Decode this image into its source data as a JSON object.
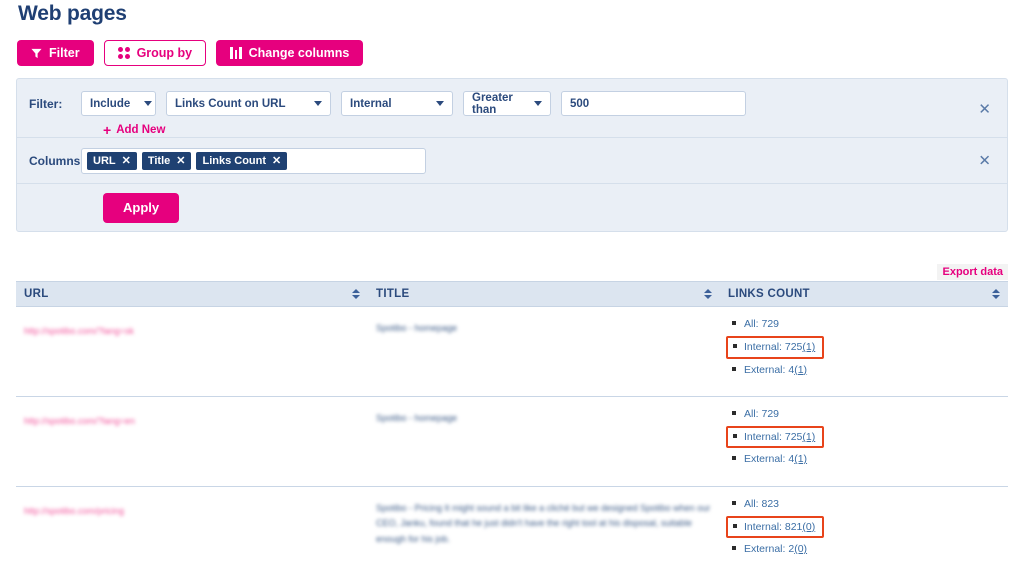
{
  "header": {
    "title": "Web pages"
  },
  "toolbar": {
    "filter_label": "Filter",
    "group_by_label": "Group by",
    "change_columns_label": "Change columns"
  },
  "filter_panel": {
    "filter_label": "Filter:",
    "columns_label": "Columns:",
    "selects": [
      {
        "name": "include-mode",
        "value": "Include"
      },
      {
        "name": "metric",
        "value": "Links Count on URL"
      },
      {
        "name": "link-type",
        "value": "Internal"
      },
      {
        "name": "comparator",
        "value": "Greater than"
      }
    ],
    "value_input": "500",
    "value_placeholder": "",
    "add_new_label": "Add New",
    "add_new_plus": "+",
    "remove_icon": "✕",
    "columns_chips": [
      {
        "label": "URL",
        "remove": "✕"
      },
      {
        "label": "Title",
        "remove": "✕"
      },
      {
        "label": "Links Count",
        "remove": "✕"
      }
    ],
    "apply_label": "Apply"
  },
  "table": {
    "export_label": "Export data",
    "columns": [
      {
        "key": "url",
        "label": "URL"
      },
      {
        "key": "title",
        "label": "TITLE"
      },
      {
        "key": "links_count",
        "label": "LINKS COUNT"
      }
    ],
    "rows": [
      {
        "url": "http://spotibo.com/?lang=sk",
        "title": "Spotibo - homepage",
        "links": {
          "all_label": "All: 729",
          "internal_label": "Internal: 725",
          "internal_sub": "(1)",
          "external_label": "External: 4",
          "external_sub": "(1)",
          "highlight": true
        }
      },
      {
        "url": "http://spotibo.com/?lang=en",
        "title": "Spotibo - homepage",
        "links": {
          "all_label": "All: 729",
          "internal_label": "Internal: 725",
          "internal_sub": "(1)",
          "external_label": "External: 4",
          "external_sub": "(1)",
          "highlight": true
        }
      },
      {
        "url": "http://spotibo.com/pricing",
        "title": "Spotibo - Pricing It might sound a bit like a cliché but we designed Spotibo when our CEO, Janku, found that he just didn't have the right tool at his disposal, suitable enough for his job.",
        "links": {
          "all_label": "All: 823",
          "internal_label": "Internal: 821",
          "internal_sub": "(0)",
          "external_label": "External: 2",
          "external_sub": "(0)",
          "highlight": true
        }
      }
    ]
  },
  "colors": {
    "brand_pink": "#e6007e",
    "navy": "#1f3f73",
    "panel_bg": "#eaeff6",
    "header_bg": "#dce5f0",
    "highlight_border": "#e8441b",
    "link_blue": "#3b6ea5"
  }
}
